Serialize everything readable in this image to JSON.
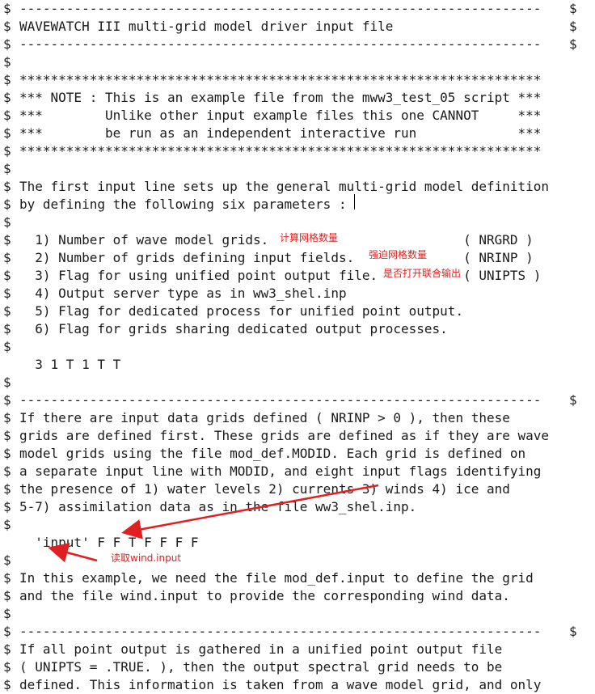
{
  "colors": {
    "text": "#1a1a1a",
    "annotation": "#e02020",
    "background": "#ffffff"
  },
  "lines": [
    {
      "m": "$",
      "t": "-------------------------------------------------------------------",
      "r": "$"
    },
    {
      "m": "$",
      "t": "WAVEWATCH III multi-grid model driver input file",
      "r": "$"
    },
    {
      "m": "$",
      "t": "-------------------------------------------------------------------",
      "r": "$"
    },
    {
      "m": "$",
      "t": "",
      "r": ""
    },
    {
      "m": "$",
      "t": "*******************************************************************",
      "r": ""
    },
    {
      "m": "$",
      "t": "*** NOTE : This is an example file from the mww3_test_05 script ***",
      "r": ""
    },
    {
      "m": "$",
      "t": "***        Unlike other input example files this one CANNOT     ***",
      "r": ""
    },
    {
      "m": "$",
      "t": "***        be run as an independent interactive run             ***",
      "r": ""
    },
    {
      "m": "$",
      "t": "*******************************************************************",
      "r": ""
    },
    {
      "m": "$",
      "t": "",
      "r": ""
    },
    {
      "m": "$",
      "t": "The first input line sets up the general multi-grid model definition",
      "r": ""
    },
    {
      "m": "$",
      "t": "by defining the following six parameters :",
      "r": ""
    },
    {
      "m": "$",
      "t": "",
      "r": ""
    },
    {
      "m": "$",
      "t": "  1) Number of wave model grids.                         ( NRGRD )",
      "r": ""
    },
    {
      "m": "$",
      "t": "  2) Number of grids defining input fields.              ( NRINP )",
      "r": ""
    },
    {
      "m": "$",
      "t": "  3) Flag for using unified point output file.           ( UNIPTS )",
      "r": ""
    },
    {
      "m": "$",
      "t": "  4) Output server type as in ww3_shel.inp",
      "r": ""
    },
    {
      "m": "$",
      "t": "  5) Flag for dedicated process for unified point output.",
      "r": ""
    },
    {
      "m": "$",
      "t": "  6) Flag for grids sharing dedicated output processes.",
      "r": ""
    },
    {
      "m": "$",
      "t": "",
      "r": ""
    },
    {
      "m": "",
      "t": "  3 1 T 1 T T",
      "r": ""
    },
    {
      "m": "$",
      "t": "",
      "r": ""
    },
    {
      "m": "$",
      "t": "-------------------------------------------------------------------",
      "r": "$"
    },
    {
      "m": "$",
      "t": "If there are input data grids defined ( NRINP > 0 ), then these",
      "r": ""
    },
    {
      "m": "$",
      "t": "grids are defined first. These grids are defined as if they are wave",
      "r": ""
    },
    {
      "m": "$",
      "t": "model grids using the file mod_def.MODID. Each grid is defined on",
      "r": ""
    },
    {
      "m": "$",
      "t": "a separate input line with MODID, and eight input flags identifying",
      "r": ""
    },
    {
      "m": "$",
      "t": "the presence of 1) water levels 2) currents 3) winds 4) ice and",
      "r": ""
    },
    {
      "m": "$",
      "t": "5-7) assimilation data as in the file ww3_shel.inp.",
      "r": ""
    },
    {
      "m": "$",
      "t": "",
      "r": ""
    },
    {
      "m": "",
      "t": "  'input' F F T F F F F",
      "r": ""
    },
    {
      "m": "$",
      "t": "",
      "r": ""
    },
    {
      "m": "$",
      "t": "In this example, we need the file mod_def.input to define the grid",
      "r": ""
    },
    {
      "m": "$",
      "t": "and the file wind.input to provide the corresponding wind data.",
      "r": ""
    },
    {
      "m": "$",
      "t": "",
      "r": ""
    },
    {
      "m": "$",
      "t": "-------------------------------------------------------------------",
      "r": "$"
    },
    {
      "m": "$",
      "t": "If all point output is gathered in a unified point output file",
      "r": ""
    },
    {
      "m": "$",
      "t": "( UNIPTS = .TRUE. ), then the output spectral grid needs to be",
      "r": ""
    },
    {
      "m": "$",
      "t": "defined. This information is taken from a wave model grid, and only",
      "r": ""
    }
  ],
  "annotations": {
    "nrgrd_note": "计算网格数量",
    "nrinp_note": "强迫网格数量",
    "unipts_note": "是否打开联合输出",
    "wind_note": "读取wind.input"
  }
}
